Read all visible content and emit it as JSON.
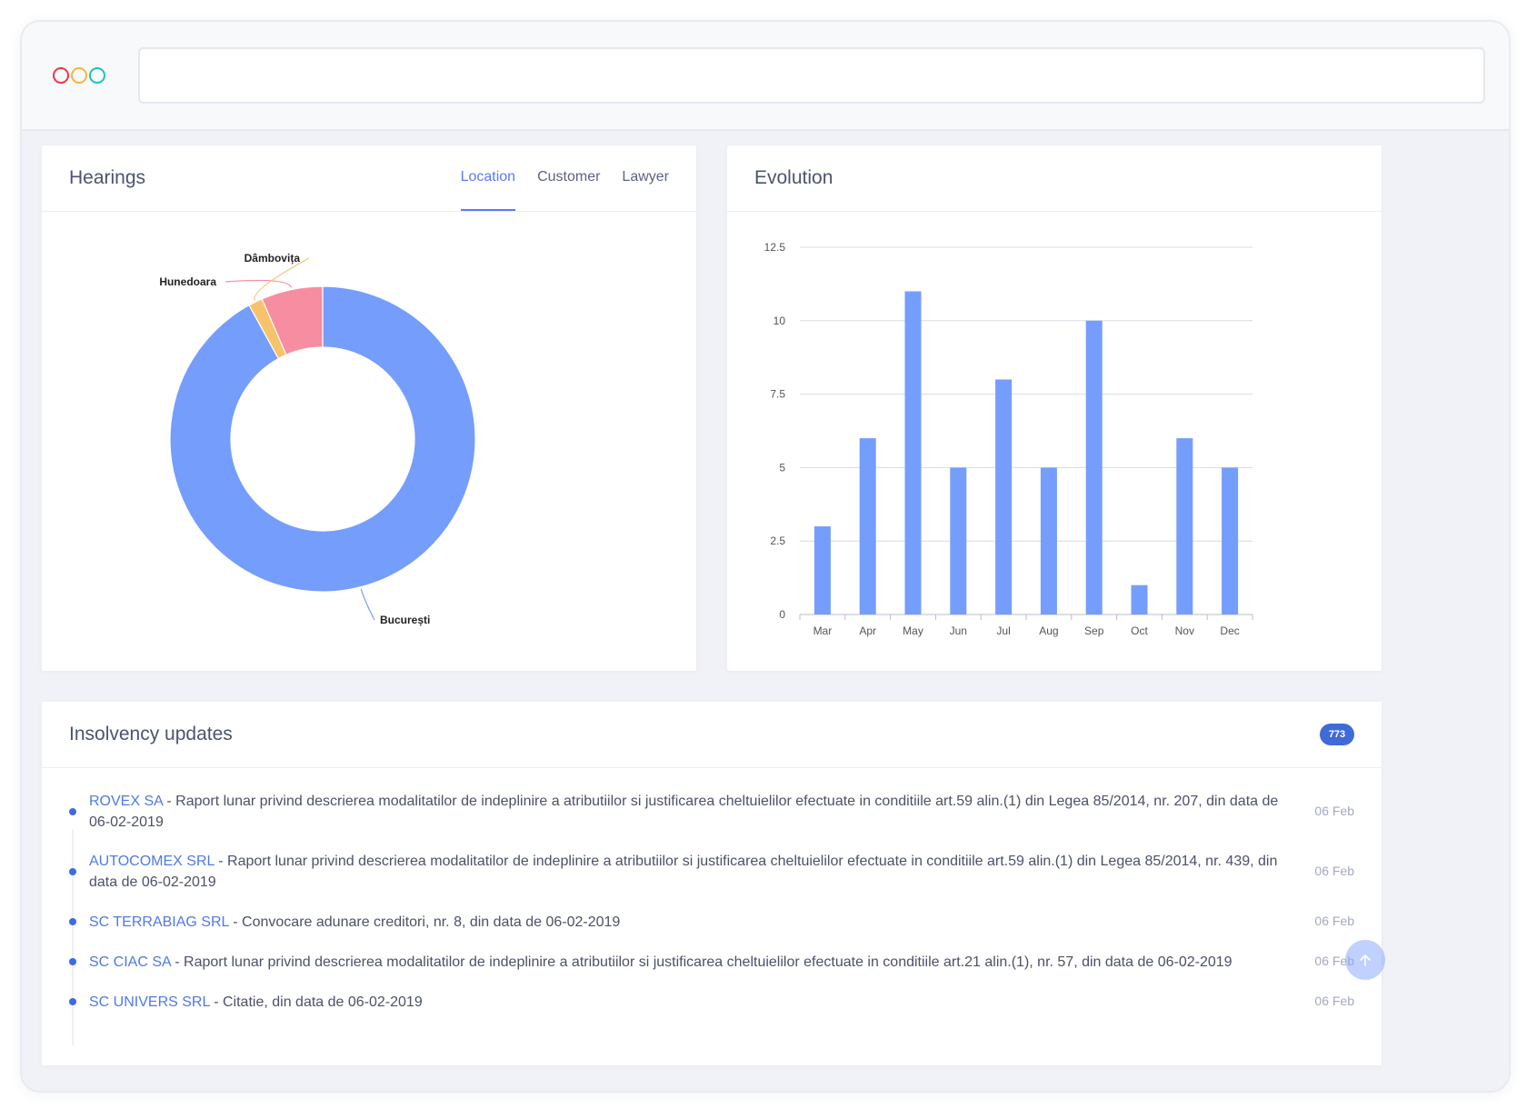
{
  "hearings": {
    "title": "Hearings",
    "tabs": [
      {
        "label": "Location",
        "active": true
      },
      {
        "label": "Customer",
        "active": false
      },
      {
        "label": "Lawyer",
        "active": false
      }
    ]
  },
  "evolution": {
    "title": "Evolution"
  },
  "insolvency": {
    "title": "Insolvency updates",
    "count": "773",
    "items": [
      {
        "company": "ROVEX SA",
        "text": " - Raport lunar privind descrierea modalitatilor de indeplinire a atributiilor si justificarea cheltuielilor efectuate in conditiile art.59 alin.(1) din Legea 85/2014, nr. 207, din data de 06-02-2019",
        "date": "06 Feb"
      },
      {
        "company": "AUTOCOMEX SRL",
        "text": " - Raport lunar privind descrierea modalitatilor de indeplinire a atributiilor si justificarea cheltuielilor efectuate in conditiile art.59 alin.(1) din Legea 85/2014, nr. 439, din data de 06-02-2019",
        "date": "06 Feb"
      },
      {
        "company": "SC TERRABIAG SRL",
        "text": " - Convocare adunare creditori, nr. 8, din data de 06-02-2019",
        "date": "06 Feb"
      },
      {
        "company": "SC CIAC SA",
        "text": " - Raport lunar privind descrierea modalitatilor de indeplinire a atributiilor si justificarea cheltuielilor efectuate in conditiile art.21 alin.(1), nr. 57, din data de 06-02-2019",
        "date": "06 Feb"
      },
      {
        "company": "SC UNIVERS SRL",
        "text": " - Citatie, din data de 06-02-2019",
        "date": "06 Feb"
      }
    ]
  },
  "icons": {
    "window_controls": [
      "red-dot",
      "yellow-dot",
      "green-dot"
    ],
    "scroll_top": "arrow-up-icon"
  },
  "colors": {
    "accent": "#5d78ff",
    "bar": "#759dfc",
    "donut": [
      "#759dfc",
      "#f78da0",
      "#f8c26a"
    ],
    "badge": "#3f6ad8"
  },
  "chart_data": [
    {
      "type": "pie",
      "donut": true,
      "labels": [
        "București",
        "Hunedoara",
        "Dâmbovița"
      ],
      "values": [
        92,
        6.5,
        1.5
      ]
    },
    {
      "type": "bar",
      "categories": [
        "Mar",
        "Apr",
        "May",
        "Jun",
        "Jul",
        "Aug",
        "Sep",
        "Oct",
        "Nov",
        "Dec"
      ],
      "values": [
        3,
        6,
        11,
        5,
        8,
        5,
        10,
        1,
        6,
        5
      ],
      "ylim": [
        0,
        12.5
      ],
      "yticks": [
        "0",
        "2.5",
        "5",
        "7.5",
        "10",
        "12.5"
      ],
      "grid": true
    }
  ]
}
